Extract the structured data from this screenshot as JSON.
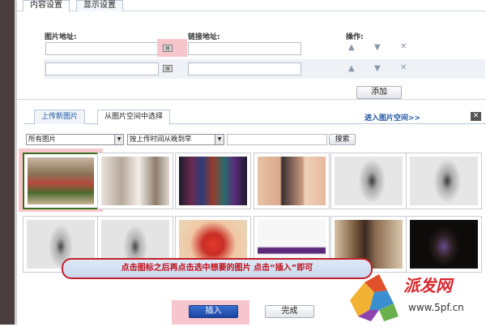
{
  "tabs": [
    {
      "label": "内容设置",
      "active": true
    },
    {
      "label": "显示设置",
      "active": false
    }
  ],
  "form": {
    "image_label": "图片地址:",
    "link_label": "链接地址:",
    "ops_label": "操作:",
    "image_icon": "image-icon",
    "add_button": "添加"
  },
  "ops_icons": [
    "arrow-up-icon",
    "arrow-down-icon",
    "delete-icon"
  ],
  "picker": {
    "tabs": [
      {
        "label": "上传新图片",
        "active": false
      },
      {
        "label": "从图片空间中选择",
        "active": true
      }
    ],
    "space_link": "进入图片空间>>",
    "filter": "所有图片",
    "sort": "按上传时间从晚到早",
    "search_value": "",
    "search_button": "搜索"
  },
  "thumbnails": [
    {
      "name": "thumb-house",
      "selected": true
    },
    {
      "name": "thumb-interior",
      "selected": false
    },
    {
      "name": "thumb-banner",
      "selected": false
    },
    {
      "name": "thumb-portraits",
      "selected": false
    },
    {
      "name": "thumb-model-1",
      "selected": false
    },
    {
      "name": "thumb-model-2",
      "selected": false
    },
    {
      "name": "thumb-model-3",
      "selected": false
    },
    {
      "name": "thumb-model-4",
      "selected": false
    },
    {
      "name": "thumb-flower",
      "selected": false
    },
    {
      "name": "thumb-purple-banner",
      "selected": false
    },
    {
      "name": "thumb-model-5",
      "selected": false
    },
    {
      "name": "thumb-model-6",
      "selected": false
    }
  ],
  "tip": "点击图标之后再点击选中想要的图片  点击“插入”即可",
  "footer": {
    "insert_button": "插入",
    "done_button": "完成"
  },
  "watermark": {
    "brand": "派发网",
    "url": "www.5pf.cn"
  },
  "colors": {
    "accent_link": "#1d56a0",
    "highlight": "#f6c6cc",
    "tip_text": "#c40d18",
    "brand_red": "#d9262c"
  }
}
